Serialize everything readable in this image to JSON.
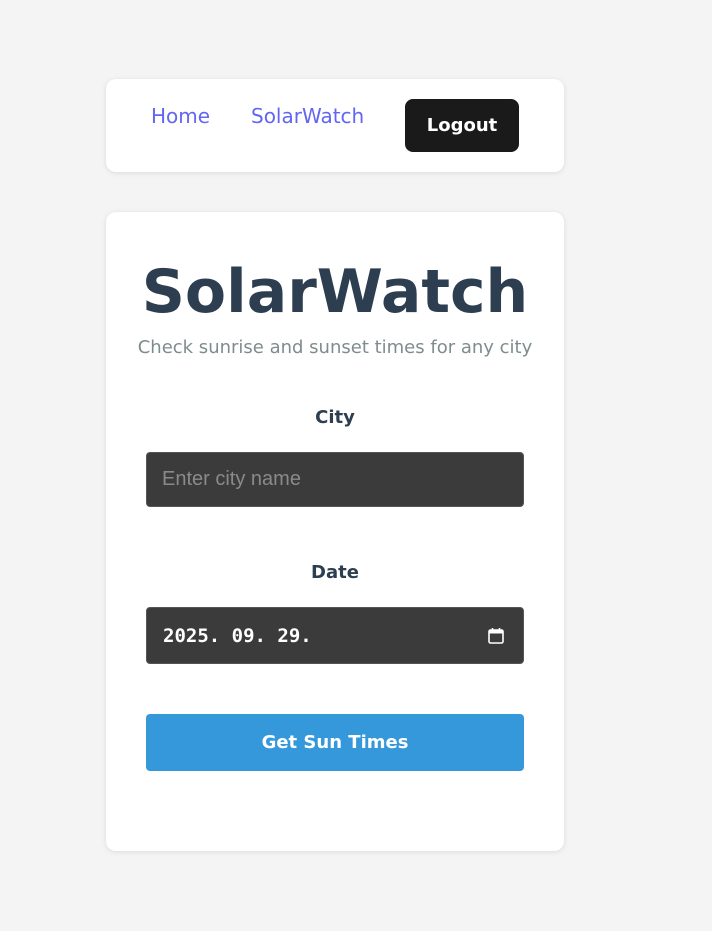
{
  "nav": {
    "links": [
      {
        "label": "Home"
      },
      {
        "label": "SolarWatch"
      }
    ],
    "logout_label": "Logout"
  },
  "main": {
    "title": "SolarWatch",
    "subtitle": "Check sunrise and sunset times for any city",
    "city": {
      "label": "City",
      "placeholder": "Enter city name",
      "value": ""
    },
    "date": {
      "label": "Date",
      "value": "2025. 09. 29."
    },
    "submit_label": "Get Sun Times"
  },
  "icons": {
    "calendar": "calendar-icon"
  },
  "colors": {
    "link": "#6366f1",
    "logout_bg": "#1a1a1a",
    "title": "#2c3e50",
    "subtitle": "#7f8c8d",
    "input_bg": "#3b3b3b",
    "submit_bg": "#3498db",
    "page_bg": "#f4f4f4"
  }
}
